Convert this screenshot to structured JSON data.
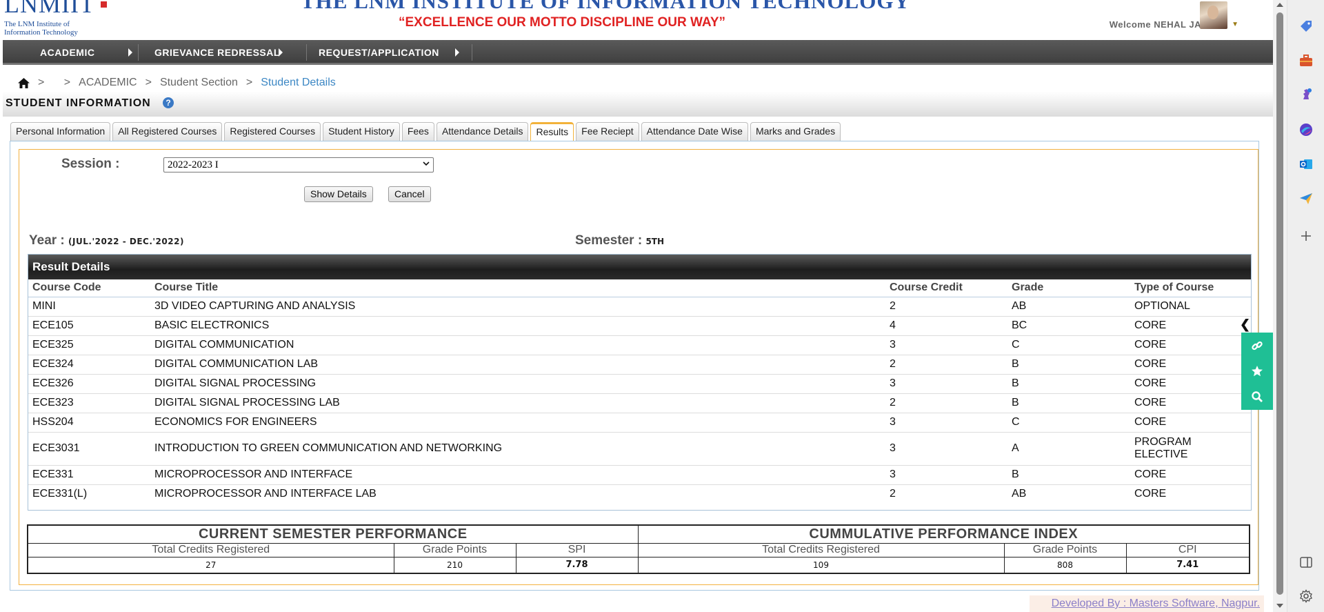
{
  "header": {
    "logo_text": "LNMIIT",
    "logo_subtitle_line1": "The LNM Institute of",
    "logo_subtitle_line2": "Information Technology",
    "institute_name": "THE LNM INSTITUTE OF INFORMATION TECHNOLOGY",
    "motto": "“EXCELLENCE OUR MOTTO DISCIPLINE OUR WAY”",
    "welcome": "Welcome NEHAL JAIN"
  },
  "menu": {
    "items": [
      {
        "label": "ACADEMIC"
      },
      {
        "label": "GRIEVANCE REDRESSAL"
      },
      {
        "label": "REQUEST/APPLICATION"
      }
    ]
  },
  "breadcrumb": {
    "sep": ">",
    "items": [
      "ACADEMIC",
      "Student Section",
      "Student Details"
    ]
  },
  "page": {
    "title": "STUDENT INFORMATION",
    "help_glyph": "?"
  },
  "tabs": [
    {
      "label": "Personal Information",
      "active": false
    },
    {
      "label": "All Registered Courses",
      "active": false
    },
    {
      "label": "Registered Courses",
      "active": false
    },
    {
      "label": "Student History",
      "active": false
    },
    {
      "label": "Fees",
      "active": false
    },
    {
      "label": "Attendance Details",
      "active": false
    },
    {
      "label": "Results",
      "active": true
    },
    {
      "label": "Fee Reciept",
      "active": false
    },
    {
      "label": "Attendance Date Wise",
      "active": false
    },
    {
      "label": "Marks and Grades",
      "active": false
    }
  ],
  "form": {
    "session_label": "Session :",
    "session_value": "2022-2023 I",
    "show_details": "Show Details",
    "cancel": "Cancel"
  },
  "summary": {
    "year_label": "Year :",
    "year_value": "(JUL.'2022 - DEC.'2022)",
    "semester_label": "Semester :",
    "semester_value": "5TH"
  },
  "results": {
    "heading": "Result Details",
    "columns": [
      "Course Code",
      "Course Title",
      "Course Credit",
      "Grade",
      "Type of Course"
    ],
    "rows": [
      {
        "code": "MINI",
        "title": "3D VIDEO CAPTURING AND ANALYSIS",
        "credit": "2",
        "grade": "AB",
        "type": "OPTIONAL"
      },
      {
        "code": "ECE105",
        "title": "BASIC ELECTRONICS",
        "credit": "4",
        "grade": "BC",
        "type": "CORE"
      },
      {
        "code": "ECE325",
        "title": "DIGITAL COMMUNICATION",
        "credit": "3",
        "grade": "C",
        "type": "CORE"
      },
      {
        "code": "ECE324",
        "title": "DIGITAL COMMUNICATION LAB",
        "credit": "2",
        "grade": "B",
        "type": "CORE"
      },
      {
        "code": "ECE326",
        "title": "DIGITAL SIGNAL PROCESSING",
        "credit": "3",
        "grade": "B",
        "type": "CORE"
      },
      {
        "code": "ECE323",
        "title": "DIGITAL SIGNAL PROCESSING LAB",
        "credit": "2",
        "grade": "B",
        "type": "CORE"
      },
      {
        "code": "HSS204",
        "title": "ECONOMICS FOR ENGINEERS",
        "credit": "3",
        "grade": "C",
        "type": "CORE"
      },
      {
        "code": "ECE3031",
        "title": "INTRODUCTION TO GREEN COMMUNICATION AND NETWORKING",
        "credit": "3",
        "grade": "A",
        "type": "PROGRAM ELECTIVE"
      },
      {
        "code": "ECE331",
        "title": "MICROPROCESSOR AND INTERFACE",
        "credit": "3",
        "grade": "B",
        "type": "CORE"
      },
      {
        "code": "ECE331(L)",
        "title": "MICROPROCESSOR AND INTERFACE LAB",
        "credit": "2",
        "grade": "AB",
        "type": "CORE"
      }
    ]
  },
  "performance": {
    "current_title": "CURRENT SEMESTER PERFORMANCE",
    "cumulative_title": "CUMMULATIVE PERFORMANCE INDEX",
    "current": {
      "credits_label": "Total Credits Registered",
      "credits": "27",
      "points_label": "Grade Points",
      "points": "210",
      "index_label": "SPI",
      "index": "7.78"
    },
    "cumulative": {
      "credits_label": "Total Credits Registered",
      "credits": "109",
      "points_label": "Grade Points",
      "points": "808",
      "index_label": "CPI",
      "index": "7.41"
    }
  },
  "footer": {
    "credit_link": "Developed By : Masters Software, Nagpur."
  },
  "side_tools": [
    "link-icon",
    "star-icon",
    "search-icon"
  ],
  "browser_sidebar": [
    "tag-icon",
    "briefcase-icon",
    "chess-icon",
    "copilot-icon",
    "outlook-icon",
    "send-icon",
    "plus-icon",
    "sidebar-toggle-icon",
    "settings-icon"
  ],
  "colors": {
    "accent_orange": "#f2b23a",
    "link_blue": "#3c87c4",
    "motto_red": "#e02222",
    "tool_green": "#1fbf95"
  }
}
